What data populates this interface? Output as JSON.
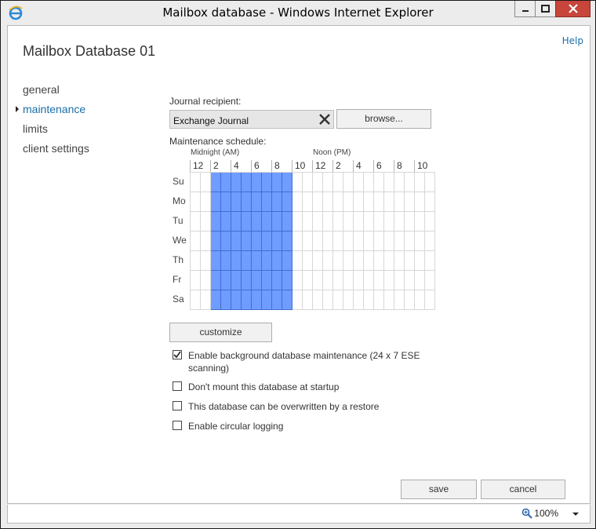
{
  "window": {
    "title": "Mailbox database - Windows Internet Explorer"
  },
  "header": {
    "help": "Help",
    "page_title": "Mailbox Database 01"
  },
  "nav": {
    "items": [
      {
        "label": "general",
        "active": false
      },
      {
        "label": "maintenance",
        "active": true
      },
      {
        "label": "limits",
        "active": false
      },
      {
        "label": "client settings",
        "active": false
      }
    ]
  },
  "journal": {
    "label": "Journal recipient:",
    "value": "Exchange Journal",
    "browse_label": "browse..."
  },
  "schedule": {
    "label": "Maintenance schedule:",
    "midnight_label": "Midnight (AM)",
    "noon_label": "Noon (PM)",
    "hour_labels": [
      "12",
      "2",
      "4",
      "6",
      "8",
      "10",
      "12",
      "2",
      "4",
      "6",
      "8",
      "10"
    ],
    "days": [
      "Su",
      "Mo",
      "Tu",
      "We",
      "Th",
      "Fr",
      "Sa"
    ],
    "active_hours": [
      1,
      2,
      3,
      4
    ],
    "customize_label": "customize"
  },
  "options": [
    {
      "label": "Enable background database maintenance (24 x 7 ESE scanning)",
      "checked": true
    },
    {
      "label": "Don't mount this database at startup",
      "checked": false
    },
    {
      "label": "This database can be overwritten by a restore",
      "checked": false
    },
    {
      "label": "Enable circular logging",
      "checked": false
    }
  ],
  "footer": {
    "save_label": "save",
    "cancel_label": "cancel"
  },
  "status": {
    "zoom": "100%"
  },
  "colors": {
    "accent": "#1a6ea8",
    "schedule_fill": "#6f9cff",
    "close_button": "#c7453a"
  }
}
